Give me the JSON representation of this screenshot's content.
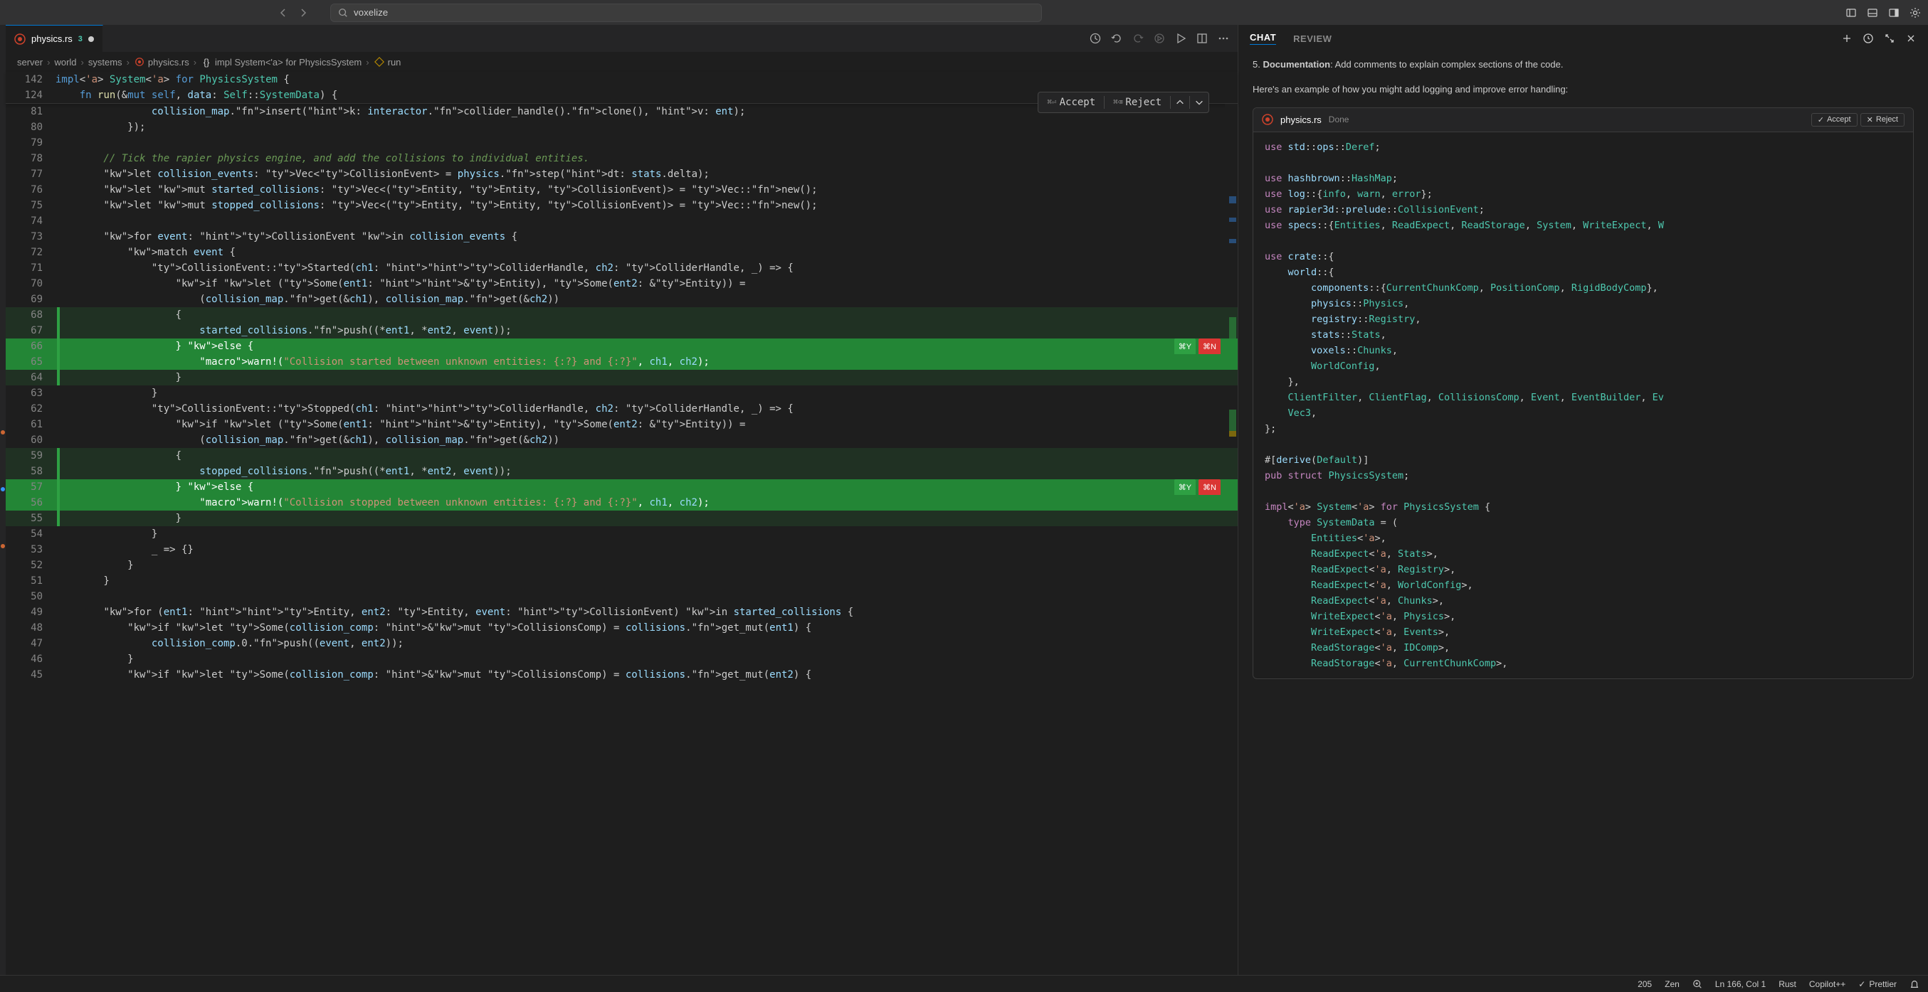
{
  "topbar": {
    "search_value": "voxelize"
  },
  "tab": {
    "filename": "physics.rs",
    "diff_count": "3"
  },
  "breadcrumb": {
    "parts": [
      "server",
      "world",
      "systems",
      "physics.rs",
      "impl System<'a> for PhysicsSystem",
      "run"
    ]
  },
  "sticky": {
    "line1_no": "142",
    "line1_code": "impl<'a> System<'a> for PhysicsSystem {",
    "line2_no": "124",
    "line2_code": "    fn run(&mut self, data: Self::SystemData) {"
  },
  "accept_reject": {
    "accept_shortcut": "⌘⏎",
    "accept_label": "Accept",
    "reject_shortcut": "⌘⌫",
    "reject_label": "Reject"
  },
  "inline_badges": {
    "accept": "⌘Y",
    "reject": "⌘N"
  },
  "code_lines": [
    {
      "n": "81",
      "t": "                collision_map.insert(k: interactor.collider_handle().clone(), v: ent);",
      "hint": [
        "k:",
        "v:"
      ]
    },
    {
      "n": "80",
      "t": "            });"
    },
    {
      "n": "79",
      "t": ""
    },
    {
      "n": "78",
      "t": "        // Tick the rapier physics engine, and add the collisions to individual entities.",
      "cmt": true
    },
    {
      "n": "77",
      "t": "        let collision_events: Vec<CollisionEvent> = physics.step(dt: stats.delta);",
      "hint": [
        "dt:"
      ]
    },
    {
      "n": "76",
      "t": "        let mut started_collisions: Vec<(Entity, Entity, CollisionEvent)> = Vec::new();"
    },
    {
      "n": "75",
      "t": "        let mut stopped_collisions: Vec<(Entity, Entity, CollisionEvent)> = Vec::new();"
    },
    {
      "n": "74",
      "t": ""
    },
    {
      "n": "73",
      "t": "        for event: CollisionEvent in collision_events {",
      "hint": [
        "CollisionEvent"
      ]
    },
    {
      "n": "72",
      "t": "            match event {"
    },
    {
      "n": "71",
      "t": "                CollisionEvent::Started(ch1: ColliderHandle, ch2: ColliderHandle, _) => {",
      "hint": [
        "ColliderHandle",
        "ColliderHandle"
      ]
    },
    {
      "n": "70",
      "t": "                    if let (Some(ent1: &Entity), Some(ent2: &Entity)) =",
      "hint": [
        "&Entity",
        "&Entity"
      ]
    },
    {
      "n": "69",
      "t": "                        (collision_map.get(&ch1), collision_map.get(&ch2))"
    },
    {
      "n": "68",
      "t": "                    {",
      "green": true
    },
    {
      "n": "67",
      "t": "                        started_collisions.push((*ent1, *ent2, event));",
      "green": true
    },
    {
      "n": "66",
      "t": "                    } else {",
      "green_strong": true,
      "badges": true
    },
    {
      "n": "65",
      "t": "                        warn!(\"Collision started between unknown entities: {:?} and {:?}\", ch1, ch2);",
      "green_strong": true
    },
    {
      "n": "64",
      "t": "                    }",
      "green": true
    },
    {
      "n": "63",
      "t": "                }"
    },
    {
      "n": "62",
      "t": "                CollisionEvent::Stopped(ch1: ColliderHandle, ch2: ColliderHandle, _) => {",
      "hint": [
        "ColliderHandle",
        "ColliderHandle"
      ]
    },
    {
      "n": "61",
      "t": "                    if let (Some(ent1: &Entity), Some(ent2: &Entity)) =",
      "hint": [
        "&Entity",
        "&Entity"
      ]
    },
    {
      "n": "60",
      "t": "                        (collision_map.get(&ch1), collision_map.get(&ch2))"
    },
    {
      "n": "59",
      "t": "                    {",
      "green": true
    },
    {
      "n": "58",
      "t": "                        stopped_collisions.push((*ent1, *ent2, event));",
      "green": true
    },
    {
      "n": "57",
      "t": "                    } else {",
      "green_strong": true,
      "badges": true
    },
    {
      "n": "56",
      "t": "                        warn!(\"Collision stopped between unknown entities: {:?} and {:?}\", ch1, ch2);",
      "green_strong": true
    },
    {
      "n": "55",
      "t": "                    }",
      "green": true
    },
    {
      "n": "54",
      "t": "                }"
    },
    {
      "n": "53",
      "t": "                _ => {}"
    },
    {
      "n": "52",
      "t": "            }"
    },
    {
      "n": "51",
      "t": "        }"
    },
    {
      "n": "50",
      "t": ""
    },
    {
      "n": "49",
      "t": "        for (ent1: Entity, ent2: Entity, event: CollisionEvent) in started_collisions {",
      "hint": [
        "Entity",
        "Entity",
        "CollisionEvent"
      ]
    },
    {
      "n": "48",
      "t": "            if let Some(collision_comp: &mut CollisionsComp) = collisions.get_mut(ent1) {",
      "hint": [
        "&mut CollisionsComp"
      ]
    },
    {
      "n": "47",
      "t": "                collision_comp.0.push((event, ent2));"
    },
    {
      "n": "46",
      "t": "            }"
    },
    {
      "n": "45",
      "t": "            if let Some(collision_comp: &mut CollisionsComp) = collisions.get_mut(ent2) {",
      "hint": [
        "&mut CollisionsComp"
      ]
    }
  ],
  "chat": {
    "tabs": {
      "chat": "CHAT",
      "review": "REVIEW"
    },
    "line1_prefix": "5. ",
    "line1_bold": "Documentation",
    "line1_rest": ": Add comments to explain complex sections of the code.",
    "line2": "Here's an example of how you might add logging and improve error handling:"
  },
  "code_card": {
    "filename": "physics.rs",
    "status": "Done",
    "accept": "Accept",
    "reject": "Reject",
    "body_lines": [
      "use std::ops::Deref;",
      "",
      "use hashbrown::HashMap;",
      "use log::{info, warn, error};",
      "use rapier3d::prelude::CollisionEvent;",
      "use specs::{Entities, ReadExpect, ReadStorage, System, WriteExpect, W",
      "",
      "use crate::{",
      "    world::{",
      "        components::{CurrentChunkComp, PositionComp, RigidBodyComp},",
      "        physics::Physics,",
      "        registry::Registry,",
      "        stats::Stats,",
      "        voxels::Chunks,",
      "        WorldConfig,",
      "    },",
      "    ClientFilter, ClientFlag, CollisionsComp, Event, EventBuilder, Ev",
      "    Vec3,",
      "};",
      "",
      "#[derive(Default)]",
      "pub struct PhysicsSystem;",
      "",
      "impl<'a> System<'a> for PhysicsSystem {",
      "    type SystemData = (",
      "        Entities<'a>,",
      "        ReadExpect<'a, Stats>,",
      "        ReadExpect<'a, Registry>,",
      "        ReadExpect<'a, WorldConfig>,",
      "        ReadExpect<'a, Chunks>,",
      "        WriteExpect<'a, Physics>,",
      "        WriteExpect<'a, Events>,",
      "        ReadStorage<'a, IDComp>,",
      "        ReadStorage<'a, CurrentChunkComp>,"
    ]
  },
  "statusbar": {
    "count": "205",
    "zen": "Zen",
    "pos": "Ln 166, Col 1",
    "lang": "Rust",
    "copilot": "Copilot++",
    "prettier": "Prettier"
  }
}
